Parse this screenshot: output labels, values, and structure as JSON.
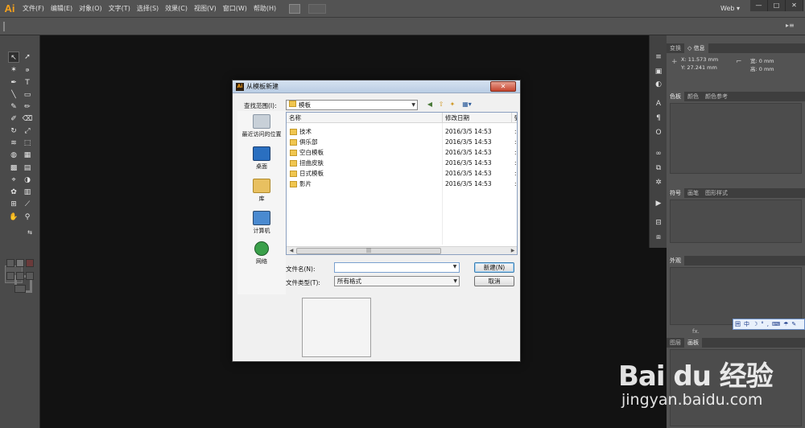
{
  "app": {
    "logo": "Ai",
    "workspace": "Web ▾"
  },
  "menu": [
    "文件(F)",
    "编辑(E)",
    "对象(O)",
    "文字(T)",
    "选择(S)",
    "效果(C)",
    "视图(V)",
    "窗口(W)",
    "帮助(H)"
  ],
  "window_controls": {
    "minimize": "—",
    "maximize": "□",
    "close": "✕"
  },
  "controlbar": {
    "options_icon": "▸≡"
  },
  "panels": {
    "transform": {
      "tabs": [
        "变换",
        "◇ 信息"
      ],
      "x": "X: 11.573 mm",
      "y": "Y: 27.241 mm",
      "w": "宽: 0 mm",
      "h": "高: 0 mm"
    },
    "color": {
      "tabs": [
        "色板",
        "颜色",
        "颜色参考"
      ]
    },
    "symbols": {
      "tabs": [
        "符号",
        "画笔",
        "图形样式"
      ]
    },
    "appearance": {
      "tabs": [
        "外观"
      ],
      "fx": "fx."
    },
    "layers": {
      "tabs": [
        "图层",
        "画板"
      ]
    }
  },
  "ime": [
    "囲",
    "中",
    "☽",
    "°",
    ",",
    "⌨",
    "☂",
    "✎"
  ],
  "dialog": {
    "title": "从模板新建",
    "title_icon": "Ai",
    "close": "✕",
    "lookin_label": "查找范围(I):",
    "lookin_value": "模板",
    "places": [
      "最近访问的位置",
      "桌面",
      "库",
      "计算机",
      "网络"
    ],
    "columns": {
      "name": "名称",
      "modified": "修改日期",
      "extra": "§"
    },
    "files": [
      {
        "name": "技术",
        "date": "2016/3/5 14:53"
      },
      {
        "name": "俱乐部",
        "date": "2016/3/5 14:53"
      },
      {
        "name": "空白模板",
        "date": "2016/3/5 14:53"
      },
      {
        "name": "扭曲皮肤",
        "date": "2016/3/5 14:53"
      },
      {
        "name": "日式模板",
        "date": "2016/3/5 14:53"
      },
      {
        "name": "影片",
        "date": "2016/3/5 14:53"
      }
    ],
    "row_extra": ":",
    "filename_label": "文件名(N):",
    "filename_value": "",
    "filetype_label": "文件类型(T):",
    "filetype_value": "所有格式",
    "new_button": "新建(N)",
    "cancel_button": "取消"
  },
  "watermark": {
    "logo": "Bai du 经验",
    "url": "jingyan.baidu.com"
  }
}
